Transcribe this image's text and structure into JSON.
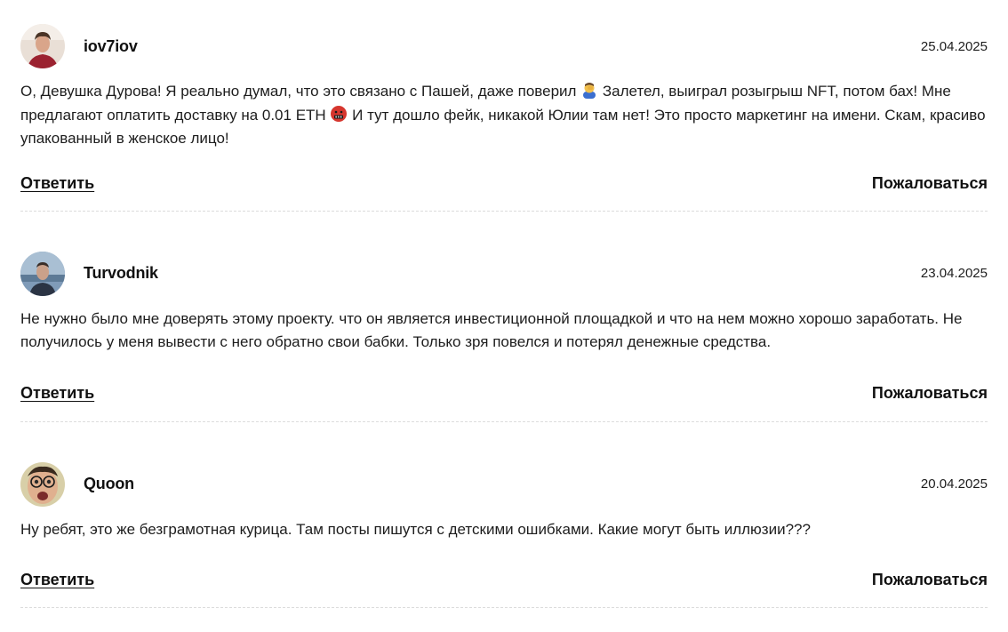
{
  "comments": [
    {
      "author": "iov7iov",
      "date": "25.04.2025",
      "text_parts": [
        "О, Девушка Дурова! Я реально думал, что это связано с Пашей, даже поверил ",
        " Залетел, выиграл розыгрыш NFT, потом бах! Мне предлагают оплатить доставку на 0.01 ETH ",
        " И тут дошло фейк, никакой Юлии там нет! Это просто маркетинг на имени. Скам, красиво упакованный в женское лицо!"
      ],
      "emojis": [
        "person-facepalming-emoji",
        "cursing-face-emoji"
      ],
      "reply_label": "Ответить",
      "report_label": "Пожаловаться"
    },
    {
      "author": "Turvodnik",
      "date": "23.04.2025",
      "text": "Не нужно было мне доверять этому проекту. что он является инвестиционной площадкой и что на нем можно хорошо заработать. Не получилось у меня вывести с него обратно свои бабки. Только зря повелся и потерял денежные средства.",
      "reply_label": "Ответить",
      "report_label": "Пожаловаться"
    },
    {
      "author": "Quoon",
      "date": "20.04.2025",
      "text": "Ну ребят, это же безграмотная курица. Там посты пишутся с детскими ошибками. Какие могут быть иллюзии???",
      "reply_label": "Ответить",
      "report_label": "Пожаловаться"
    }
  ]
}
